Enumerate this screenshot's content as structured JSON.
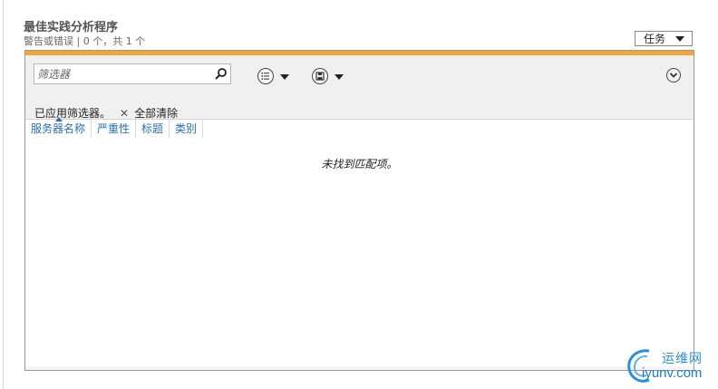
{
  "header": {
    "title": "最佳实践分析程序",
    "subtitle": "警告或错误 | 0 个，共 1 个",
    "tasks_label": "任务"
  },
  "toolbar": {
    "filter_placeholder": "筛选器",
    "applied_label": "已应用筛选器。",
    "clear_all_label": "全部清除"
  },
  "table": {
    "columns": [
      "服务器名称",
      "严重性",
      "标题",
      "类别"
    ],
    "empty_message": "未找到匹配项。"
  },
  "watermark": {
    "top_text": "运维网",
    "bottom_text": "iyunv.com"
  },
  "colors": {
    "accent_bar": "#f5a638",
    "column_header_text": "#2a6fb0"
  }
}
